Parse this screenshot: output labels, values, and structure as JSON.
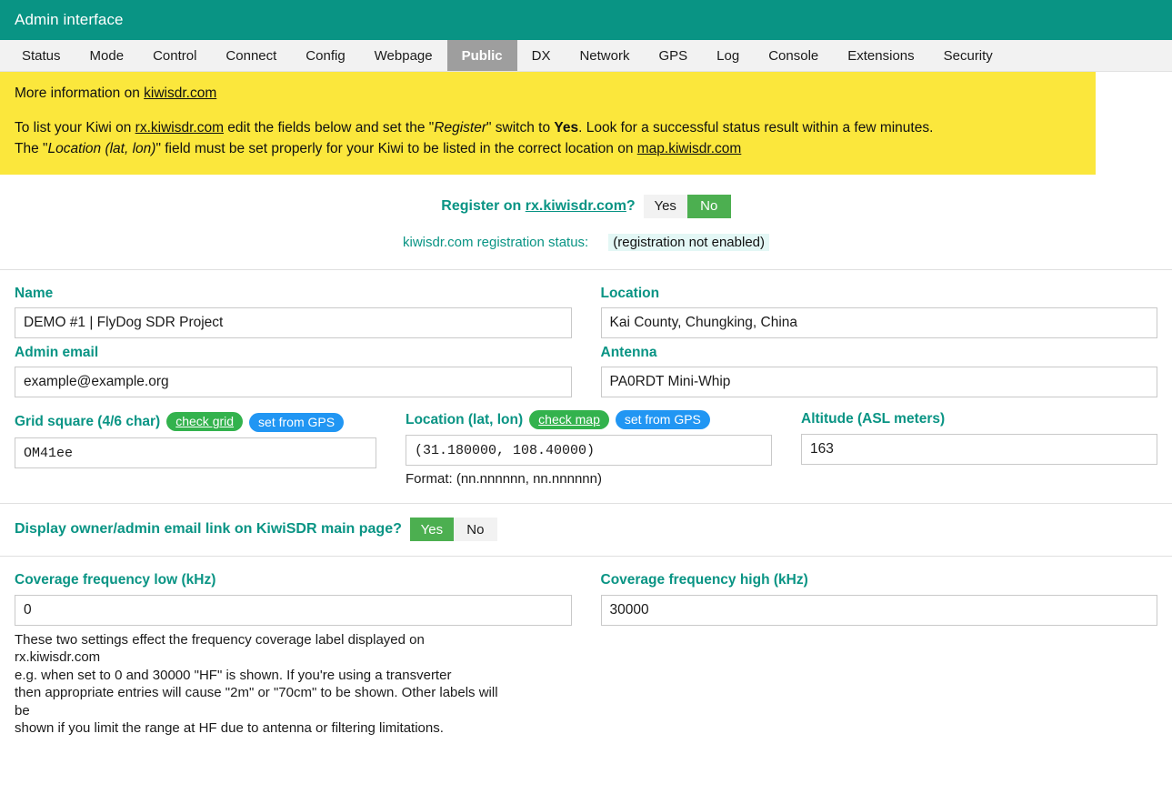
{
  "header": {
    "title": "Admin interface"
  },
  "tabs": [
    {
      "label": "Status",
      "active": false
    },
    {
      "label": "Mode",
      "active": false
    },
    {
      "label": "Control",
      "active": false
    },
    {
      "label": "Connect",
      "active": false
    },
    {
      "label": "Config",
      "active": false
    },
    {
      "label": "Webpage",
      "active": false
    },
    {
      "label": "Public",
      "active": true
    },
    {
      "label": "DX",
      "active": false
    },
    {
      "label": "Network",
      "active": false
    },
    {
      "label": "GPS",
      "active": false
    },
    {
      "label": "Log",
      "active": false
    },
    {
      "label": "Console",
      "active": false
    },
    {
      "label": "Extensions",
      "active": false
    },
    {
      "label": "Security",
      "active": false
    }
  ],
  "banner": {
    "line1_pre": "More information on ",
    "line1_link": "kiwisdr.com",
    "p2_a": "To list your Kiwi on ",
    "p2_link": "rx.kiwisdr.com",
    "p2_b": " edit the fields below and set the \"",
    "p2_em": "Register",
    "p2_c": "\" switch to ",
    "p2_strong": "Yes",
    "p2_d": ". Look for a successful status result within a few minutes.",
    "p3_a": "The \"",
    "p3_em": "Location (lat, lon)",
    "p3_b": "\" field must be set properly for your Kiwi to be listed in the correct location on ",
    "p3_link": "map.kiwisdr.com"
  },
  "register": {
    "label_pre": "Register on ",
    "label_link": "rx.kiwisdr.com",
    "label_post": "?",
    "yes": "Yes",
    "no": "No",
    "selected": "No",
    "status_label": "kiwisdr.com registration status:",
    "status_value": "(registration not enabled)"
  },
  "fields": {
    "name": {
      "label": "Name",
      "value": "DEMO #1 | FlyDog SDR Project"
    },
    "location": {
      "label": "Location",
      "value": "Kai County, Chungking, China"
    },
    "admin_email": {
      "label": "Admin email",
      "value": "example@example.org",
      "placeholder": "example@example.org"
    },
    "antenna": {
      "label": "Antenna",
      "value": "PA0RDT Mini-Whip"
    },
    "grid_square": {
      "label": "Grid square (4/6 char)",
      "check_badge": "check grid",
      "gps_badge": "set from GPS",
      "value": "OM41ee"
    },
    "lat_lon": {
      "label": "Location (lat, lon)",
      "check_badge": "check map",
      "gps_badge": "set from GPS",
      "value": "(31.180000, 108.40000)",
      "hint": "Format: (nn.nnnnnn, nn.nnnnnn)"
    },
    "altitude": {
      "label": "Altitude (ASL meters)",
      "value": "163"
    }
  },
  "email_link": {
    "label": "Display owner/admin email link on KiwiSDR main page?",
    "yes": "Yes",
    "no": "No",
    "selected": "Yes"
  },
  "coverage": {
    "low_label": "Coverage frequency low (kHz)",
    "low_value": "0",
    "high_label": "Coverage frequency high (kHz)",
    "high_value": "30000",
    "note1": "These two settings effect the frequency coverage label displayed on",
    "note2": "rx.kiwisdr.com",
    "note3": "e.g. when set to 0 and 30000 \"HF\" is shown. If you're using a transverter",
    "note4": "then appropriate entries will cause \"2m\" or \"70cm\" to be shown. Other labels will",
    "note5": "be",
    "note6": "shown if you limit the range at HF due to antenna or filtering limitations."
  },
  "colors": {
    "header_teal": "#099484",
    "banner_yellow": "#fbe73c",
    "accent_green": "#4caf50",
    "badge_green": "#33b24d",
    "badge_blue": "#2196f3",
    "tab_active": "#9e9e9e"
  }
}
